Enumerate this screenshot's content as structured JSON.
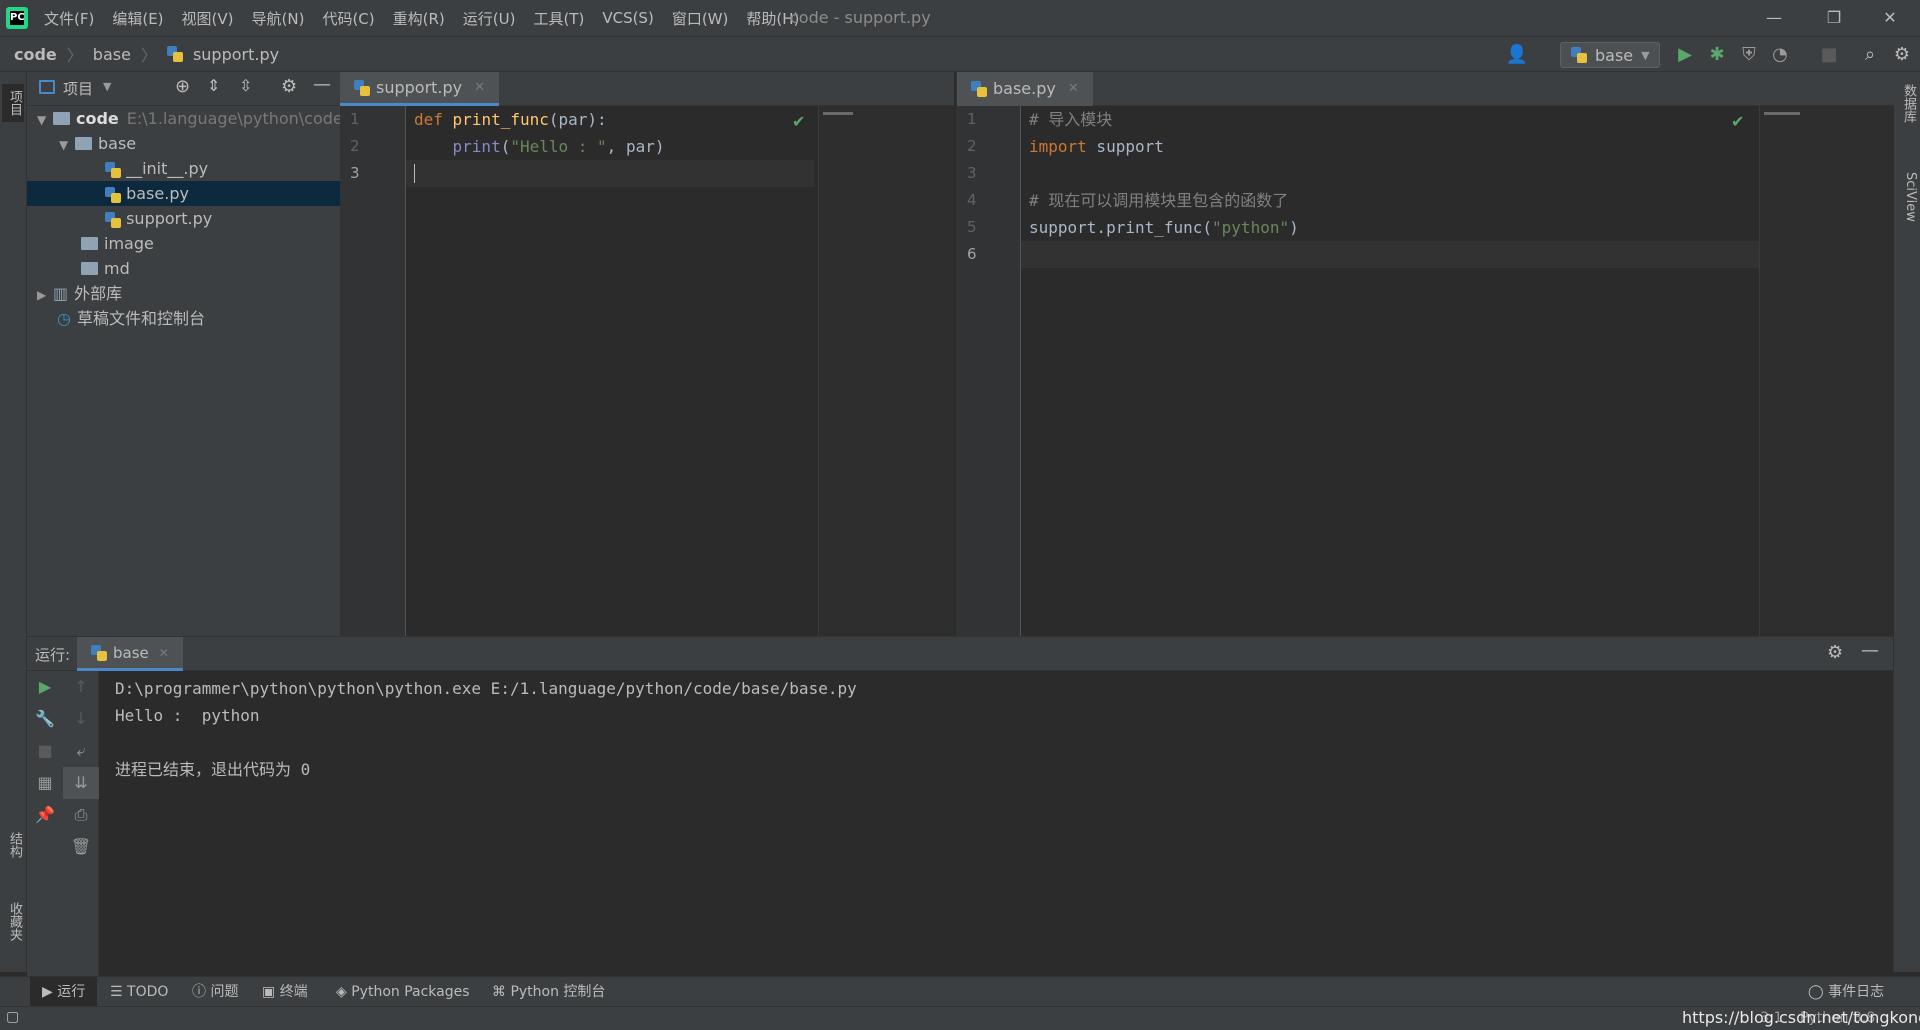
{
  "menu": [
    "文件(F)",
    "编辑(E)",
    "视图(V)",
    "导航(N)",
    "代码(C)",
    "重构(R)",
    "运行(U)",
    "工具(T)",
    "VCS(S)",
    "窗口(W)",
    "帮助(H)"
  ],
  "window_title": "code - support.py",
  "window_buttons": {
    "minimize": "—",
    "restore": "❐",
    "close": "✕"
  },
  "breadcrumb": {
    "root": "code",
    "folder": "base",
    "file": "support.py"
  },
  "run_config": "base",
  "left_stripe": {
    "project": "项目",
    "structure": "结构",
    "favorites": "收藏夹"
  },
  "right_stripe": {
    "database": "数据库",
    "sciview": "SciView"
  },
  "project": {
    "title": "项目",
    "tree": [
      {
        "label": "code",
        "hint": "E:\\1.language\\python\\code"
      },
      {
        "label": "base"
      },
      {
        "label": "__init__.py"
      },
      {
        "label": "base.py"
      },
      {
        "label": "support.py"
      },
      {
        "label": "image"
      },
      {
        "label": "md"
      },
      {
        "label": "外部库"
      },
      {
        "label": "草稿文件和控制台"
      }
    ]
  },
  "editor_left": {
    "tab": "support.py",
    "lines": [
      "1",
      "2",
      "3"
    ],
    "code": {
      "l1_kw": "def",
      "l1_fn": "print_func",
      "l1_rest": "(par):",
      "l2_indent": "    ",
      "l2_builtin": "print",
      "l2_open": "(",
      "l2_str": "\"Hello : \"",
      "l2_rest": ", par)"
    }
  },
  "editor_right": {
    "tab": "base.py",
    "lines": [
      "1",
      "2",
      "3",
      "4",
      "5",
      "6"
    ],
    "code": {
      "l1_cmt": "# 导入模块",
      "l2_kw": "import",
      "l2_rest": " support",
      "l4_cmt": "# 现在可以调用模块里包含的函数了",
      "l5_pre": "support.print_func(",
      "l5_str": "\"python\"",
      "l5_post": ")"
    }
  },
  "run": {
    "label": "运行:",
    "tab": "base",
    "console": [
      "D:\\programmer\\python\\python\\python.exe E:/1.language/python/code/base/base.py",
      "Hello :  python",
      "",
      "进程已结束，退出代码为 0"
    ]
  },
  "bottom_tabs": [
    "运行",
    "TODO",
    "问题",
    "终端",
    "Python Packages",
    "Python 控制台"
  ],
  "event_log": "事件日志",
  "status": {
    "position": "3:1",
    "interpreter": "Python 3.8",
    "watermark": "https://blog.csdn.net/tongkongyu"
  },
  "colors": {
    "accent": "#4a88c7",
    "keyword": "#cc7832",
    "function": "#ffc66d",
    "string": "#6a8759",
    "comment": "#808080",
    "run_green": "#59a869"
  },
  "icons": [
    "pycharm-logo-icon",
    "user-icon",
    "run-icon",
    "debug-icon",
    "coverage-icon",
    "profile-icon",
    "stop-icon",
    "search-icon",
    "gear-icon",
    "python-file-icon",
    "folder-icon",
    "check-icon"
  ]
}
